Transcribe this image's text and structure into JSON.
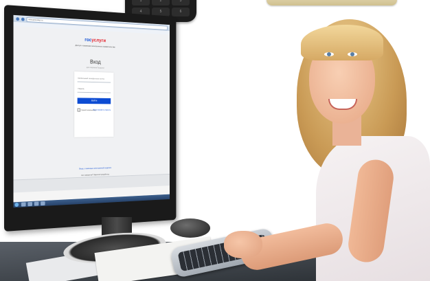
{
  "scene": {
    "description_name": "woman-at-computer-photo"
  },
  "phone": {
    "keys": [
      "1",
      "2",
      "3",
      "4",
      "5",
      "6"
    ]
  },
  "monitor": {
    "browser": {
      "url": "esia.gosuslugi.ru"
    },
    "login_page": {
      "logo_part1": "гос",
      "logo_part2": "услуги",
      "logo_subtitle": "Доступ к сервисам электронного правительства",
      "title": "Вход",
      "subtitle": "для портала Госуслуг",
      "login_placeholder": "Мобильный телефон или почта",
      "password_placeholder": "Пароль",
      "submit_label": "Войти",
      "remember_label": "Чужой компьютер",
      "forgot_label": "Восстановить пароль",
      "alt_login": "Вход с помощью электронной подписи",
      "register_prompt": "Нет аккаунта? Зарегистрируйтесь"
    }
  },
  "colors": {
    "gosuslugi_blue": "#0d4cd3",
    "gosuslugi_red": "#e3202a"
  }
}
